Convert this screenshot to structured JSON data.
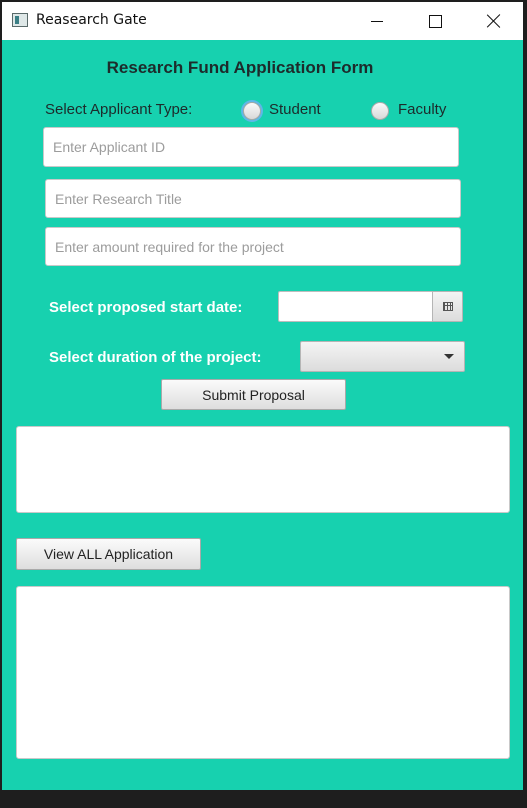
{
  "window": {
    "title": "Reasearch Gate"
  },
  "form": {
    "heading": "Research Fund Application Form",
    "applicant_type_label": "Select Applicant Type:",
    "applicant_types": [
      "Student",
      "Faculty"
    ],
    "selected_type": "Student",
    "applicant_id": {
      "placeholder": "Enter Applicant ID",
      "value": ""
    },
    "research_title": {
      "placeholder": "Enter Research Title",
      "value": ""
    },
    "amount": {
      "placeholder": "Enter amount required for the project",
      "value": ""
    },
    "start_date_label": "Select proposed start date:",
    "start_date_value": "",
    "duration_label": "Select duration of the project:",
    "duration_value": "",
    "submit_label": "Submit Proposal",
    "result_text": "",
    "view_all_label": "View ALL Application",
    "applications_text": ""
  },
  "colors": {
    "background": "#17d1af",
    "title_text": "#1d2b2b",
    "label_text": "#ffffff"
  }
}
